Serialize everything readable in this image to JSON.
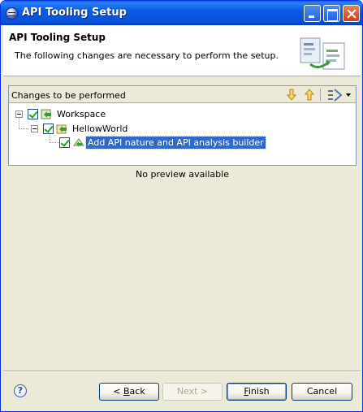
{
  "window": {
    "title": "API Tooling Setup",
    "controls": [
      "minimize",
      "maximize",
      "close"
    ]
  },
  "header": {
    "title": "API Tooling Setup",
    "description": "The following changes are necessary to perform the setup."
  },
  "changes_panel": {
    "title": "Changes to be performed",
    "toolbar": [
      "next-change-down-icon",
      "previous-change-up-icon",
      "filter-dropdown-icon"
    ],
    "tree": [
      {
        "label": "Workspace",
        "level": 0,
        "checked": true,
        "expanded": true,
        "icon": "workspace-change-icon"
      },
      {
        "label": "HellowWorld",
        "level": 1,
        "checked": true,
        "expanded": true,
        "icon": "project-change-icon"
      },
      {
        "label": "Add API nature and API analysis builder",
        "level": 2,
        "checked": true,
        "selected": true,
        "icon": "change-item-icon"
      }
    ]
  },
  "preview": {
    "text": "No preview available"
  },
  "buttons": {
    "back": {
      "prefix": "< ",
      "mnemonic": "B",
      "rest": "ack",
      "enabled": true
    },
    "next": {
      "label": "Next >",
      "enabled": false
    },
    "finish": {
      "mnemonic": "F",
      "rest": "inish",
      "enabled": true,
      "default": true
    },
    "cancel": {
      "label": "Cancel",
      "enabled": true
    }
  },
  "colors": {
    "titlebar": "#0b5be6",
    "selection": "#316ac5",
    "dialog_bg": "#ece9d8"
  }
}
